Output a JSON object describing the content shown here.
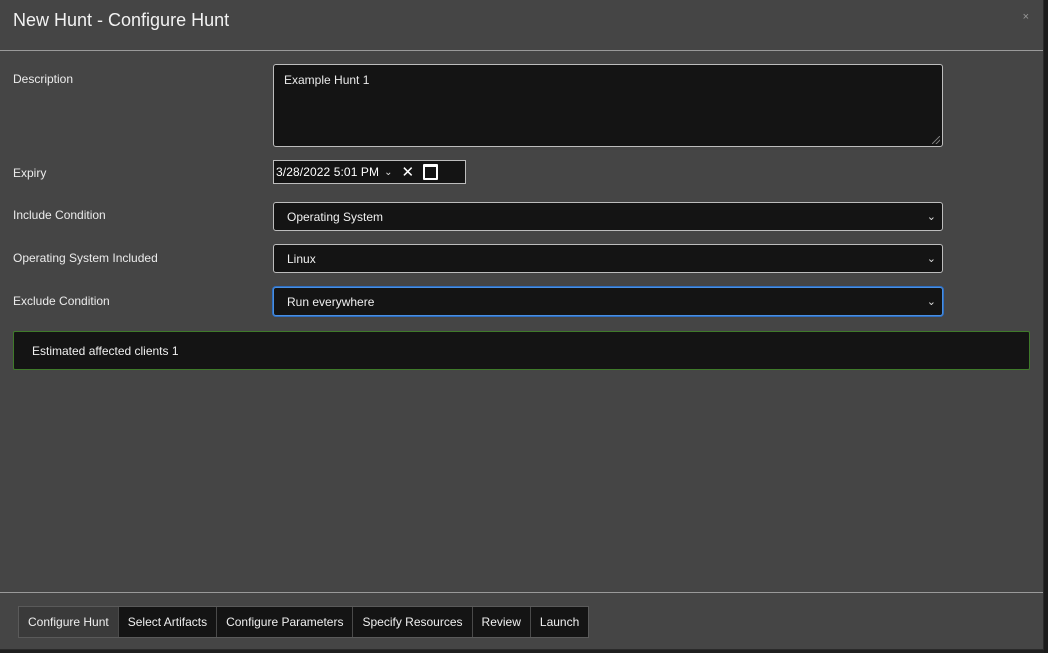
{
  "modal": {
    "title": "New Hunt - Configure Hunt",
    "close_label": "×"
  },
  "form": {
    "description": {
      "label": "Description",
      "value": "Example Hunt 1"
    },
    "expiry": {
      "label": "Expiry",
      "date_value": "3/28/2022 5:01  PM",
      "chevron": "⌄",
      "clear": "✕"
    },
    "include_condition": {
      "label": "Include Condition",
      "value": "Operating System"
    },
    "os_included": {
      "label": "Operating System Included",
      "value": "Linux"
    },
    "exclude_condition": {
      "label": "Exclude Condition",
      "value": "Run everywhere"
    },
    "select_chevron": "⌄"
  },
  "alert": {
    "text": "Estimated affected clients 1"
  },
  "steps": [
    {
      "label": "Configure Hunt",
      "active": true
    },
    {
      "label": "Select Artifacts",
      "active": false
    },
    {
      "label": "Configure Parameters",
      "active": false
    },
    {
      "label": "Specify Resources",
      "active": false
    },
    {
      "label": "Review",
      "active": false
    },
    {
      "label": "Launch",
      "active": false
    }
  ],
  "colors": {
    "accent_focus": "#4a8fe0",
    "alert_border": "#3f7a2a",
    "panel_bg": "#454545",
    "input_bg": "#141414"
  }
}
